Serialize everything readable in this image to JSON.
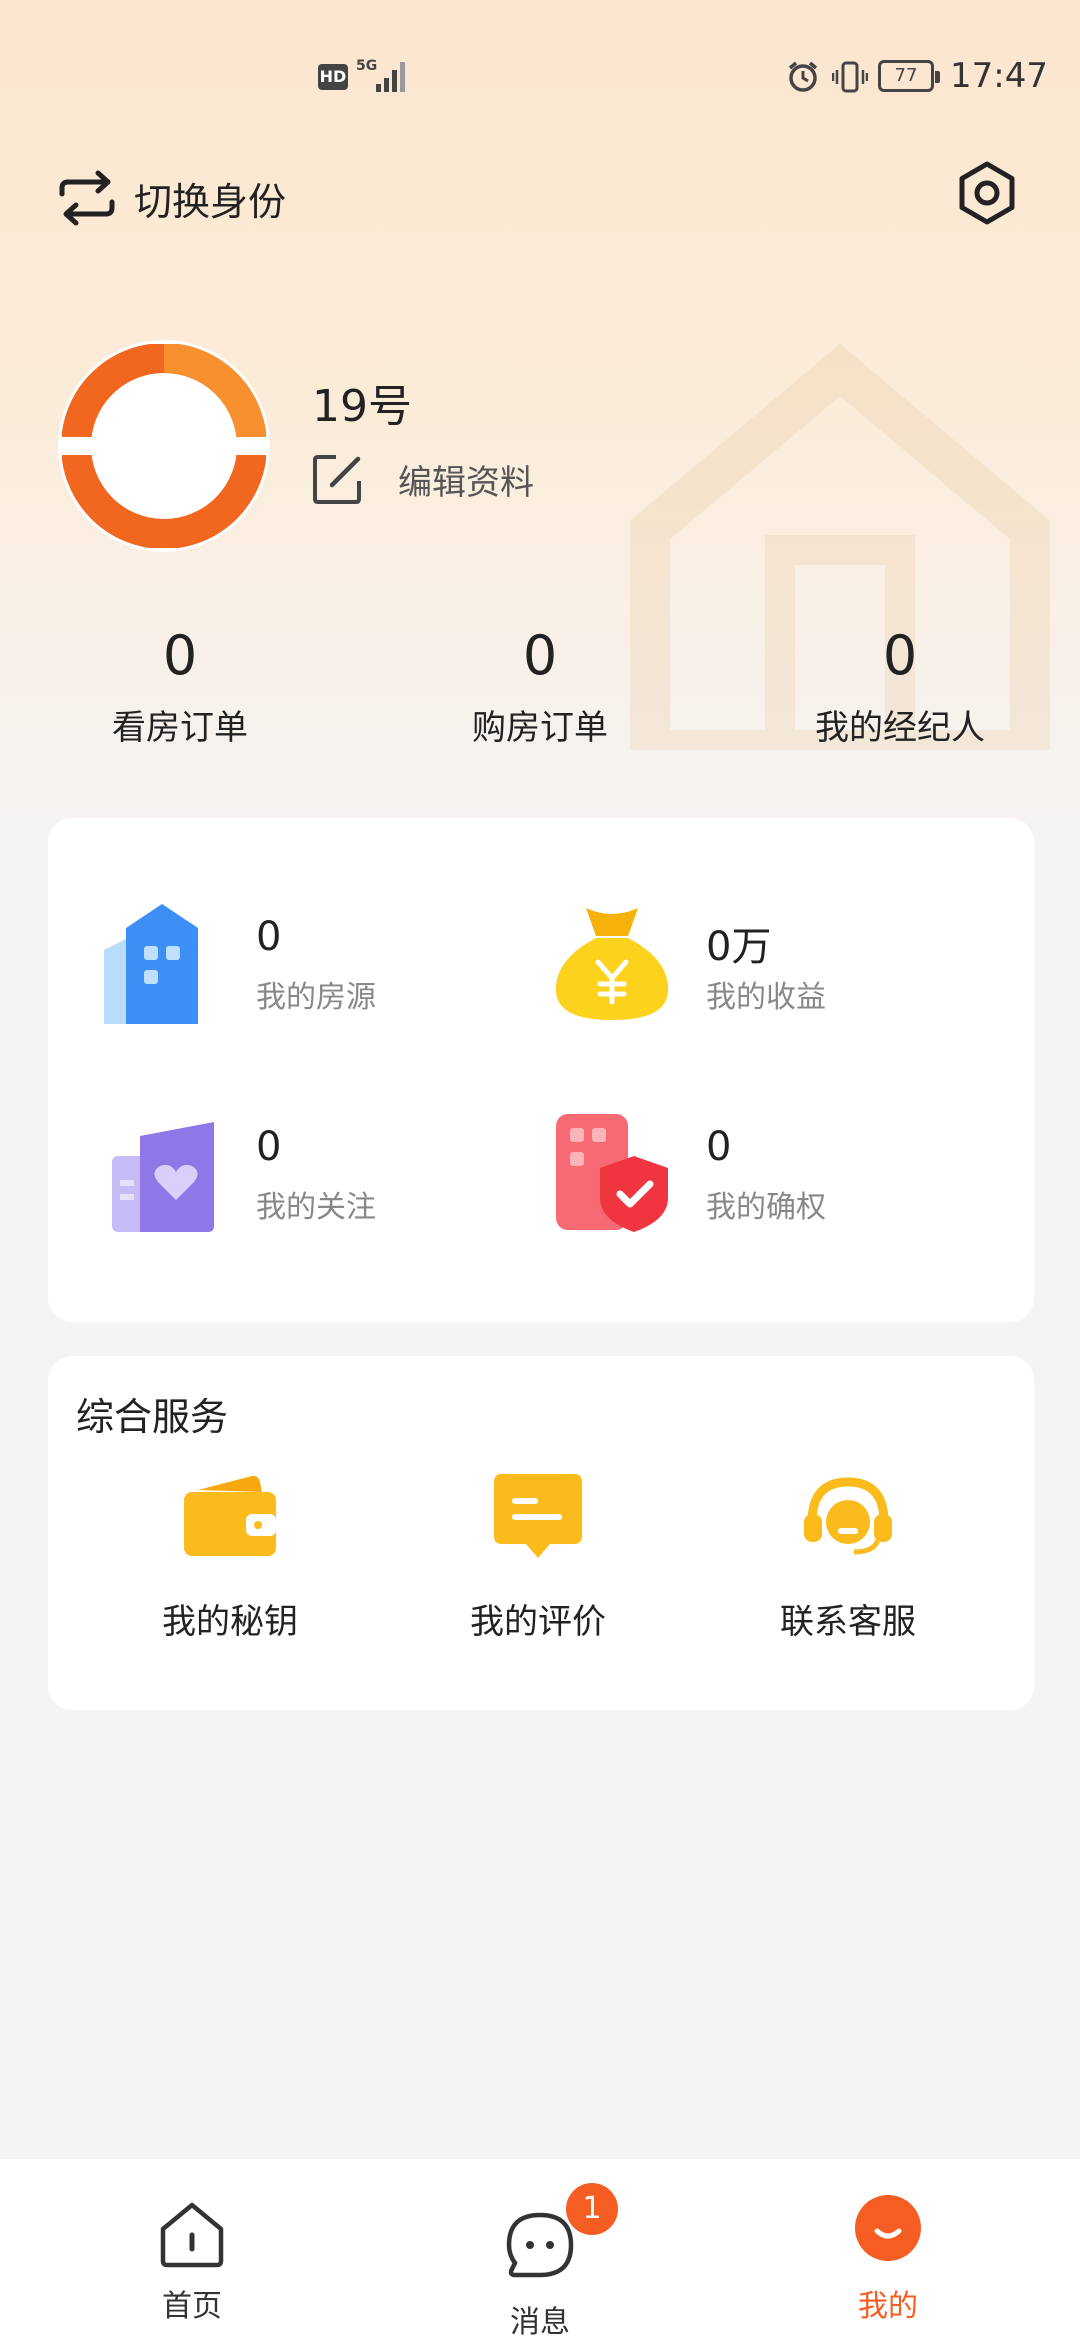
{
  "status_bar": {
    "hd": "HD",
    "network": "5G",
    "battery": "77",
    "time": "17:47"
  },
  "header": {
    "switch_identity_label": "切换身份"
  },
  "profile": {
    "username": "19号",
    "edit_label": "编辑资料"
  },
  "stats": [
    {
      "value": "0",
      "label": "看房订单"
    },
    {
      "value": "0",
      "label": "购房订单"
    },
    {
      "value": "0",
      "label": "我的经纪人"
    }
  ],
  "assets": {
    "listings": {
      "value": "0",
      "label": "我的房源",
      "icon": "building-icon"
    },
    "earnings": {
      "value": "0万",
      "label": "我的收益",
      "icon": "money-bag-icon"
    },
    "follows": {
      "value": "0",
      "label": "我的关注",
      "icon": "heart-building-icon"
    },
    "rights": {
      "value": "0",
      "label": "我的确权",
      "icon": "shield-check-icon"
    }
  },
  "services": {
    "title": "综合服务",
    "items": [
      {
        "label": "我的秘钥",
        "icon": "wallet-icon"
      },
      {
        "label": "我的评价",
        "icon": "comment-icon"
      },
      {
        "label": "联系客服",
        "icon": "headset-icon"
      }
    ]
  },
  "bottom_nav": {
    "items": [
      {
        "label": "首页",
        "icon": "home-icon"
      },
      {
        "label": "消息",
        "icon": "message-icon",
        "badge": "1"
      },
      {
        "label": "我的",
        "icon": "profile-icon"
      }
    ],
    "active_color": "#f55d22",
    "inactive_color": "#333333"
  },
  "colors": {
    "accent": "#f55d22",
    "services_icon": "#f7b216"
  }
}
